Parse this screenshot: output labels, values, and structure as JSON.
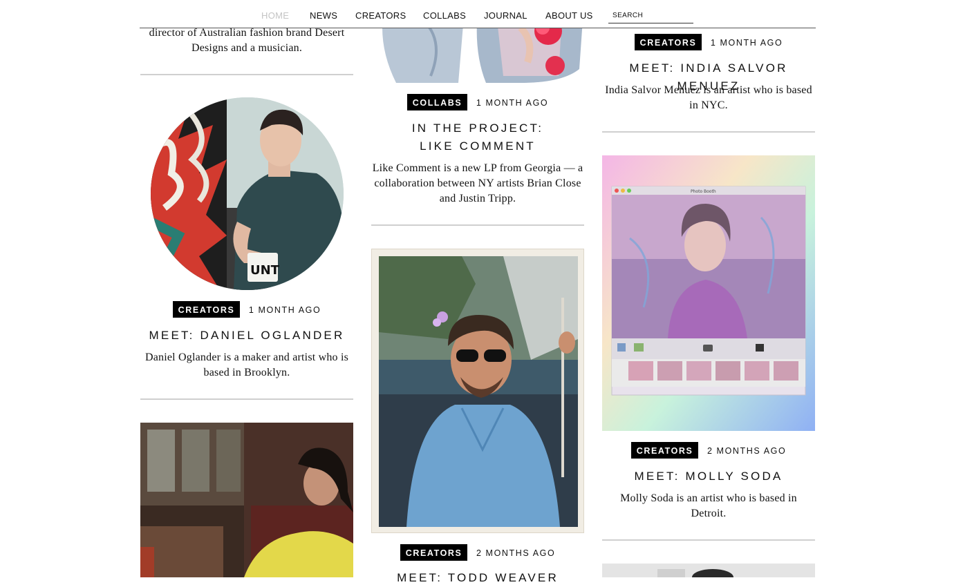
{
  "nav": {
    "items": [
      "HOME",
      "NEWS",
      "CREATORS",
      "COLLABS",
      "JOURNAL",
      "ABOUT US"
    ],
    "search_placeholder": "SEARCH"
  },
  "col1": {
    "top_desc": "director of Australian fashion brand Desert Designs and a musician.",
    "post1": {
      "category": "CREATORS",
      "date": "1 MONTH AGO",
      "title": "MEET: DANIEL OGLANDER",
      "desc": "Daniel Oglander is a maker and artist who is based in Brooklyn."
    }
  },
  "col2": {
    "post1": {
      "category": "COLLABS",
      "date": "1 MONTH AGO",
      "title": "IN THE PROJECT: LIKE COMMENT",
      "desc": "Like Comment is a new LP from Georgia — a collaboration between NY artists Brian Close and Justin Tripp."
    },
    "post2": {
      "category": "CREATORS",
      "date": "2 MONTHS AGO",
      "title": "MEET: TODD WEAVER"
    }
  },
  "col3": {
    "post1": {
      "category": "CREATORS",
      "date": "1 MONTH AGO",
      "title": "MEET: INDIA SALVOR MENUEZ",
      "desc": "India Salvor Menuez is an artist who is based in NYC."
    },
    "post2": {
      "category": "CREATORS",
      "date": "2 MONTHS AGO",
      "title": "MEET: MOLLY SODA",
      "desc": "Molly Soda is an artist who is based in Detroit."
    },
    "photobooth_title": "Photo Booth"
  },
  "colors": {
    "badge_bg": "#000000",
    "rule": "#cfcfcf",
    "nav_active": "#c4c4c4"
  }
}
